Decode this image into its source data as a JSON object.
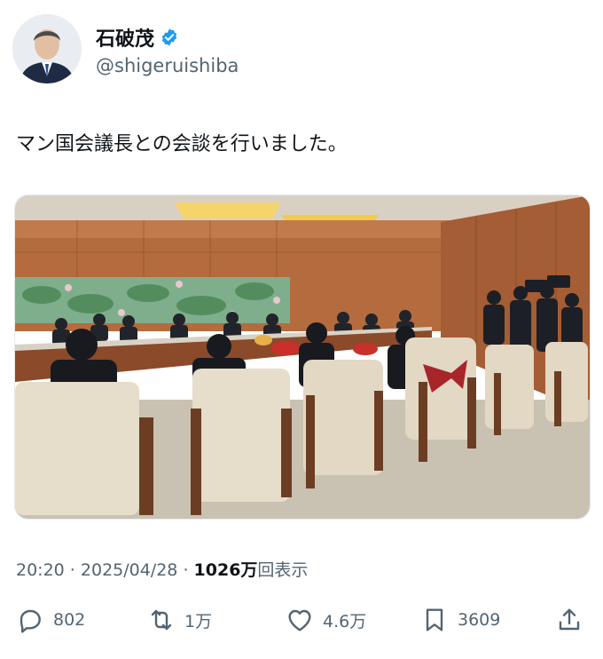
{
  "author": {
    "display_name": "石破茂",
    "handle": "@shigeruishiba",
    "verified": true
  },
  "tweet": {
    "text": "マン国会議長との会談を行いました。"
  },
  "meta": {
    "time": "20:20",
    "sep1": " · ",
    "date": "2025/04/28",
    "sep2": " · ",
    "views": "1026万",
    "views_label": "回表示"
  },
  "actions": {
    "reply_count": "802",
    "retweet_count": "1万",
    "like_count": "4.6万",
    "bookmark_count": "3609"
  },
  "colors": {
    "verified": "#1d9bf0",
    "secondary_text": "#536471"
  },
  "icons": [
    "verified-badge-icon",
    "reply-icon",
    "retweet-icon",
    "like-icon",
    "bookmark-icon",
    "share-icon"
  ]
}
